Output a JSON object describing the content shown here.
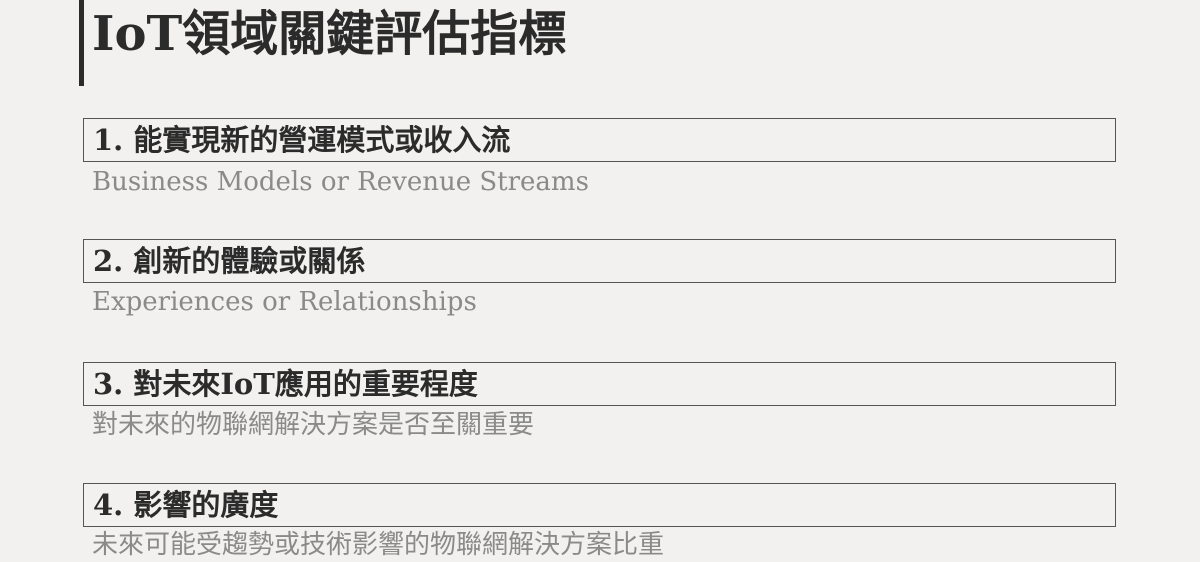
{
  "title": "IoT領域關鍵評估指標",
  "items": [
    {
      "heading": "1. 能實現新的營運模式或收入流",
      "subtitle": "Business Models or Revenue Streams"
    },
    {
      "heading": "2. 創新的體驗或關係",
      "subtitle": "Experiences or Relationships"
    },
    {
      "heading": "3. 對未來IoT應用的重要程度",
      "subtitle": "對未來的物聯網解決方案是否至關重要"
    },
    {
      "heading": "4. 影響的廣度",
      "subtitle": "未來可能受趨勢或技術影響的物聯網解決方案比重"
    }
  ]
}
